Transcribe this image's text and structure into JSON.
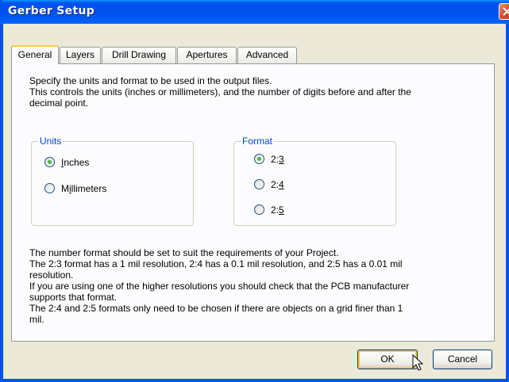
{
  "window": {
    "title": "Gerber Setup"
  },
  "tabs": [
    {
      "label": "General",
      "active": true
    },
    {
      "label": "Layers",
      "active": false
    },
    {
      "label": "Drill Drawing",
      "active": false
    },
    {
      "label": "Apertures",
      "active": false
    },
    {
      "label": "Advanced",
      "active": false
    }
  ],
  "intro": {
    "line1": "Specify the units and format to be used in the output files.",
    "line2": "This controls the units (inches or millimeters), and the number of digits before and after the",
    "line3": "decimal point."
  },
  "units": {
    "legend": "Units",
    "options": [
      {
        "label": "Inches",
        "accel_index": 0,
        "selected": true
      },
      {
        "label": "Millimeters",
        "accel_index": 1,
        "selected": false
      }
    ]
  },
  "format": {
    "legend": "Format",
    "options": [
      {
        "label": "2:3",
        "selected": true
      },
      {
        "label": "2:4",
        "selected": false
      },
      {
        "label": "2:5",
        "selected": false
      }
    ]
  },
  "notes": [
    "The number format should be set to suit the requirements of your Project.",
    "The 2:3 format has a 1 mil resolution, 2:4 has a 0.1 mil resolution, and 2:5 has a 0.01 mil",
    "resolution.",
    "If you are using one of the higher resolutions you should check that the PCB manufacturer",
    "supports that format.",
    "The 2:4 and 2:5 formats only need to be chosen if there are objects on a grid finer than 1",
    "mil."
  ],
  "buttons": {
    "ok": "OK",
    "cancel": "Cancel"
  },
  "colors": {
    "titlebar": "#0054e3",
    "group_legend": "#0046d5",
    "radio_selected": "#21a121"
  }
}
